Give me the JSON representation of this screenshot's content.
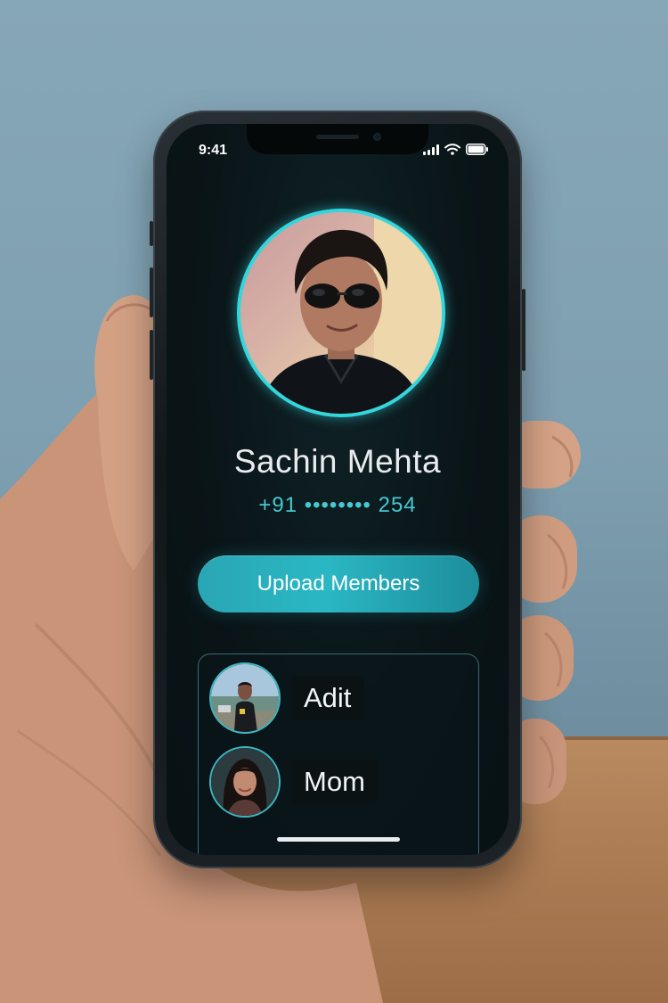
{
  "status_bar": {
    "time": "9:41",
    "icons": [
      "cellular-signal-icon",
      "wifi-icon",
      "battery-icon"
    ]
  },
  "profile": {
    "name": "Sachin Mehta",
    "phone": "+91 •••••••• 254",
    "avatar_icon": "profile-photo",
    "ring_color": "#34d6dd"
  },
  "actions": {
    "upload_label": "Upload Members",
    "accent_color": "#2ab7c4"
  },
  "members": [
    {
      "name": "Adit",
      "avatar": "member-photo"
    },
    {
      "name": "Mom",
      "avatar": "member-photo"
    }
  ]
}
